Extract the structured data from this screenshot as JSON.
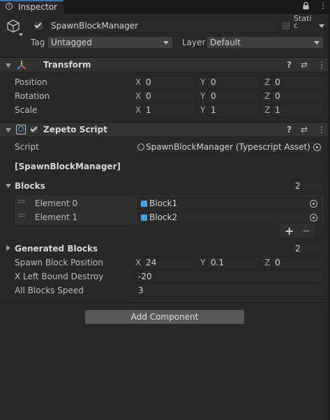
{
  "tab": {
    "title": "Inspector"
  },
  "object": {
    "name": "SpawnBlockManager",
    "static_label": "Stati c",
    "tag_label": "Tag",
    "tag_value": "Untagged",
    "layer_label": "Layer",
    "layer_value": "Default"
  },
  "transform": {
    "title": "Transform",
    "rows": [
      {
        "label": "Position",
        "x": "0",
        "y": "0",
        "z": "0"
      },
      {
        "label": "Rotation",
        "x": "0",
        "y": "0",
        "z": "0"
      },
      {
        "label": "Scale",
        "x": "1",
        "y": "1",
        "z": "1"
      }
    ],
    "axes": {
      "x": "X",
      "y": "Y",
      "z": "Z"
    }
  },
  "zepeto": {
    "title": "Zepeto Script",
    "script_label": "Script",
    "script_value": "SpawnBlockManager (Typescript Asset)",
    "class_header": "[SpawnBlockManager]",
    "blocks_label": "Blocks",
    "blocks_count": "2",
    "elements": [
      {
        "label": "Element 0",
        "value": "Block1"
      },
      {
        "label": "Element 1",
        "value": "Block2"
      }
    ],
    "plus": "+",
    "minus": "−",
    "generated_label": "Generated Blocks",
    "generated_count": "2",
    "spawn_label": "Spawn Block Position",
    "spawn_x": "24",
    "spawn_y": "0.1",
    "spawn_z": "0",
    "xleft_label": "X Left Bound Destroy",
    "xleft_value": "-20",
    "speed_label": "All Blocks Speed",
    "speed_value": "3"
  },
  "add_component": "Add Component",
  "colors": {
    "background": "#282828",
    "header": "#323232",
    "field": "#2a2a2a",
    "accent_cube": "#4aa1d8"
  }
}
